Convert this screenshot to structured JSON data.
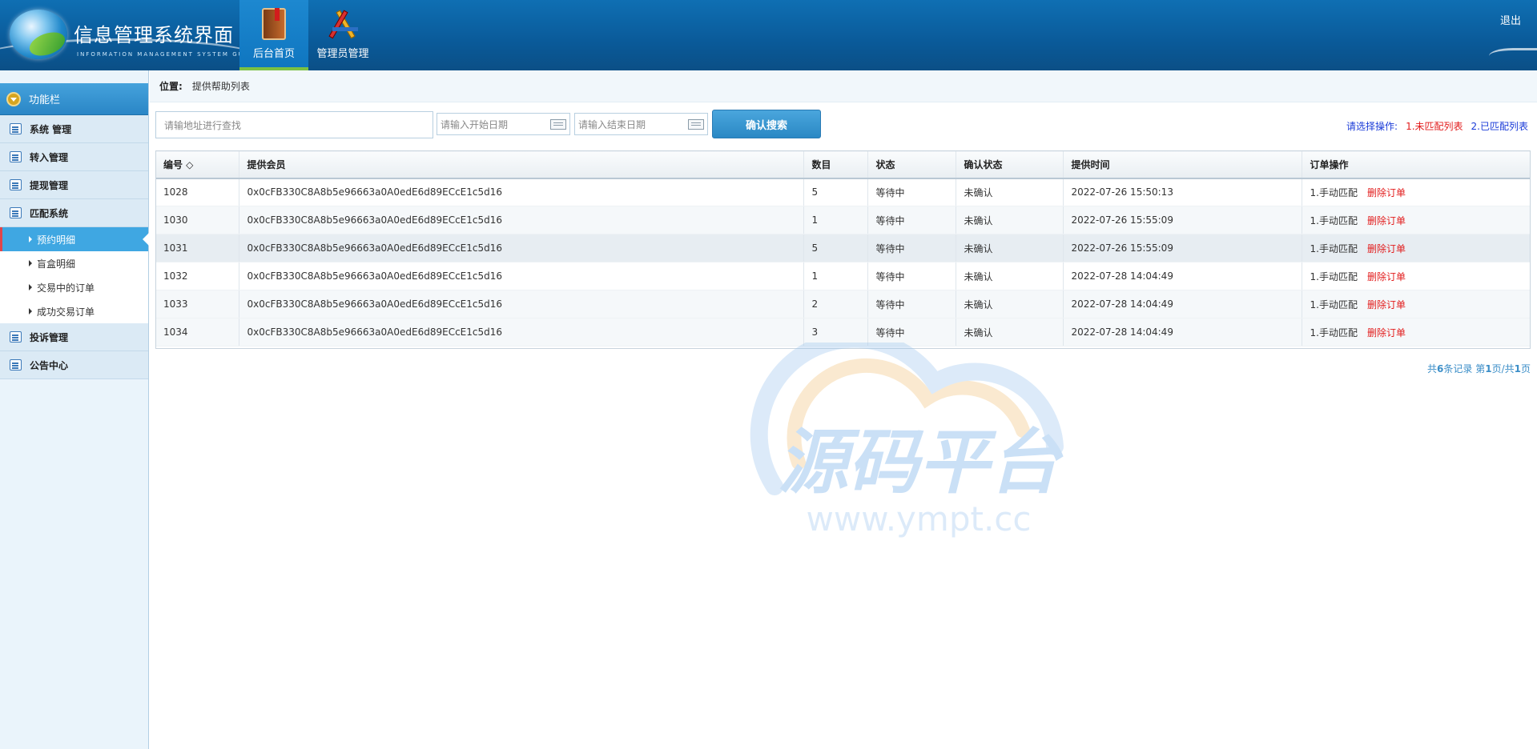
{
  "header": {
    "title": "信息管理系统界面",
    "subtitle": "INFORMATION MANAGEMENT SYSTEM GUI",
    "nav": [
      {
        "label": "后台首页",
        "icon": "book-icon",
        "active": true
      },
      {
        "label": "管理员管理",
        "icon": "tools-icon",
        "active": false
      }
    ],
    "logout": "退出"
  },
  "sidebar": {
    "head": "功能栏",
    "groups": [
      {
        "label": "系统 管理",
        "icon": "list-icon"
      },
      {
        "label": "转入管理",
        "icon": "comment-icon"
      },
      {
        "label": "提现管理",
        "icon": "comment-icon"
      },
      {
        "label": "匹配系统",
        "icon": "calendar-icon"
      },
      {
        "label": "投诉管理",
        "icon": "calendar-icon"
      },
      {
        "label": "公告中心",
        "icon": "edit-icon"
      }
    ],
    "subitems": [
      {
        "label": "预约明细",
        "active": true
      },
      {
        "label": "盲盒明细",
        "active": false
      },
      {
        "label": "交易中的订单",
        "active": false
      },
      {
        "label": "成功交易订单",
        "active": false
      }
    ]
  },
  "crumb": {
    "label": "位置:",
    "page": "提供帮助列表"
  },
  "search": {
    "address_placeholder": "请输地址进行查找",
    "start_placeholder": "请输入开始日期",
    "end_placeholder": "请输入结束日期",
    "button": "确认搜索"
  },
  "ops": {
    "label": "请选择操作:",
    "op1": "1.未匹配列表",
    "op2": "2.已匹配列表"
  },
  "table": {
    "columns": [
      "编号 ◇",
      "提供会员",
      "数目",
      "状态",
      "确认状态",
      "提供时间",
      "订单操作"
    ],
    "rows": [
      {
        "id": "1028",
        "member": "0x0cFB330C8A8b5e96663a0A0edE6d89ECcE1c5d16",
        "count": "5",
        "status": "等待中",
        "confirm": "未确认",
        "time": "2022-07-26 15:50:13",
        "manual": "1.手动匹配",
        "del": "删除订单"
      },
      {
        "id": "1030",
        "member": "0x0cFB330C8A8b5e96663a0A0edE6d89ECcE1c5d16",
        "count": "1",
        "status": "等待中",
        "confirm": "未确认",
        "time": "2022-07-26 15:55:09",
        "manual": "1.手动匹配",
        "del": "删除订单"
      },
      {
        "id": "1031",
        "member": "0x0cFB330C8A8b5e96663a0A0edE6d89ECcE1c5d16",
        "count": "5",
        "status": "等待中",
        "confirm": "未确认",
        "time": "2022-07-26 15:55:09",
        "manual": "1.手动匹配",
        "del": "删除订单"
      },
      {
        "id": "1032",
        "member": "0x0cFB330C8A8b5e96663a0A0edE6d89ECcE1c5d16",
        "count": "1",
        "status": "等待中",
        "confirm": "未确认",
        "time": "2022-07-28 14:04:49",
        "manual": "1.手动匹配",
        "del": "删除订单"
      },
      {
        "id": "1033",
        "member": "0x0cFB330C8A8b5e96663a0A0edE6d89ECcE1c5d16",
        "count": "2",
        "status": "等待中",
        "confirm": "未确认",
        "time": "2022-07-28 14:04:49",
        "manual": "1.手动匹配",
        "del": "删除订单"
      },
      {
        "id": "1034",
        "member": "0x0cFB330C8A8b5e96663a0A0edE6d89ECcE1c5d16",
        "count": "3",
        "status": "等待中",
        "confirm": "未确认",
        "time": "2022-07-28 14:04:49",
        "manual": "1.手动匹配",
        "del": "删除订单"
      }
    ]
  },
  "pager": {
    "prefix": "共",
    "total": "6",
    "mid": "条记录 第",
    "page": "1",
    "mid2": "页/共",
    "pages": "1",
    "suffix": "页"
  },
  "watermark": {
    "title": "源码平台",
    "url": "www.ympt.cc"
  },
  "colors": {
    "header": "#0a5a99",
    "accent_green": "#7bc143",
    "danger": "#e21c1c",
    "link": "#1a3bd8"
  }
}
